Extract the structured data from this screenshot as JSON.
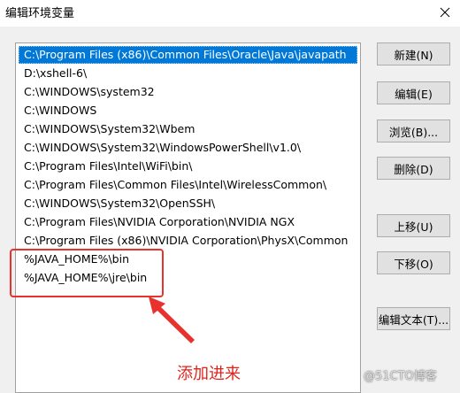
{
  "window": {
    "title": "编辑环境变量"
  },
  "path_list": {
    "items": [
      {
        "label": "C:\\Program Files (x86)\\Common Files\\Oracle\\Java\\javapath",
        "selected": true
      },
      {
        "label": "D:\\xshell-6\\"
      },
      {
        "label": "C:\\WINDOWS\\system32"
      },
      {
        "label": "C:\\WINDOWS"
      },
      {
        "label": "C:\\WINDOWS\\System32\\Wbem"
      },
      {
        "label": "C:\\WINDOWS\\System32\\WindowsPowerShell\\v1.0\\"
      },
      {
        "label": "C:\\Program Files\\Intel\\WiFi\\bin\\"
      },
      {
        "label": "C:\\Program Files\\Common Files\\Intel\\WirelessCommon\\"
      },
      {
        "label": "C:\\WINDOWS\\System32\\OpenSSH\\"
      },
      {
        "label": "C:\\Program Files\\NVIDIA Corporation\\NVIDIA NGX"
      },
      {
        "label": "C:\\Program Files (x86)\\NVIDIA Corporation\\PhysX\\Common"
      },
      {
        "label": "%JAVA_HOME%\\bin"
      },
      {
        "label": "%JAVA_HOME%\\jre\\bin"
      }
    ]
  },
  "buttons": {
    "new": "新建(N)",
    "edit": "编辑(E)",
    "browse": "浏览(B)...",
    "delete": "删除(D)",
    "move_up": "上移(U)",
    "move_down": "下移(O)",
    "edit_text": "编辑文本(T)..."
  },
  "annotation": {
    "text": "添加进来",
    "color": "#e2231a"
  },
  "watermark": {
    "text": "@51CTO博客"
  },
  "colors": {
    "selection": "#0078d7",
    "annotation": "#e8322e"
  }
}
